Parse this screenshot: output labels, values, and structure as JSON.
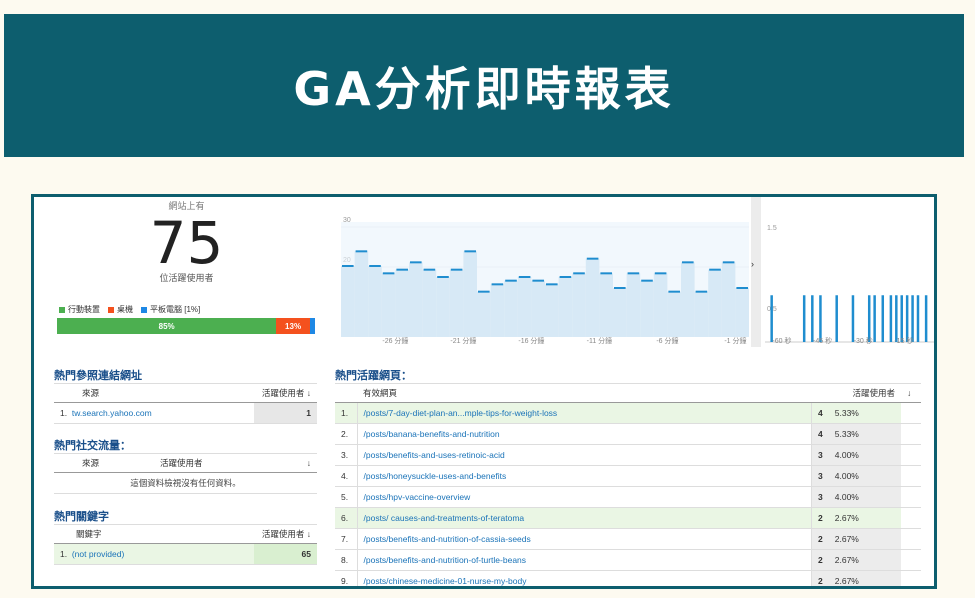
{
  "banner": {
    "title": "GA分析即時報表"
  },
  "realtime": {
    "site_label": "網站上有",
    "count": "75",
    "active_label": "位活躍使用者",
    "devices": [
      {
        "label": "行動裝置",
        "color": "#4caf50",
        "percent_label": "85%",
        "share": 0.85
      },
      {
        "label": "桌機",
        "color": "#f4511e",
        "percent_label": "13%",
        "share": 0.13
      },
      {
        "label": "平板電腦 [1%]",
        "color": "#1e88e5",
        "percent_label": "",
        "share": 0.02
      }
    ]
  },
  "chart_data": [
    {
      "type": "line",
      "ylim": [
        0,
        30
      ],
      "yticks": [
        "30",
        "20",
        "10"
      ],
      "xticks": [
        "-26 分鐘",
        "-21 分鐘",
        "-16 分鐘",
        "-11 分鐘",
        "-6 分鐘",
        "-1 分鐘"
      ],
      "x_minutes": [
        -30,
        -29,
        -28,
        -27,
        -26,
        -25,
        -24,
        -23,
        -22,
        -21,
        -20,
        -19,
        -18,
        -17,
        -16,
        -15,
        -14,
        -13,
        -12,
        -11,
        -10,
        -9,
        -8,
        -7,
        -6,
        -5,
        -4,
        -3,
        -2,
        -1
      ],
      "values": [
        18,
        22,
        18,
        16,
        17,
        19,
        17,
        15,
        17,
        22,
        11,
        13,
        14,
        15,
        14,
        13,
        15,
        16,
        20,
        16,
        12,
        16,
        14,
        16,
        11,
        19,
        11,
        17,
        19,
        12
      ]
    },
    {
      "type": "bar",
      "ylim": [
        0,
        1.5
      ],
      "yticks": [
        "1.5",
        "0.5"
      ],
      "xticks": [
        "-60 秒",
        "-45 秒",
        "-30 秒",
        "-15 秒"
      ],
      "x_seconds": [
        -60,
        -48,
        -45,
        -42,
        -36,
        -30,
        -24,
        -22,
        -19,
        -16,
        -14,
        -12,
        -10,
        -8,
        -6,
        -3
      ],
      "values": [
        1,
        1,
        1,
        1,
        1,
        1,
        1,
        1,
        1,
        1,
        1,
        1,
        1,
        1,
        1,
        1
      ]
    }
  ],
  "referrals": {
    "title": "熱門參照連結網址",
    "col_source": "來源",
    "col_users": "活躍使用者 ↓",
    "rows": [
      {
        "n": "1.",
        "source": "tw.search.yahoo.com",
        "users": "1"
      }
    ]
  },
  "social": {
    "title": "熱門社交流量：",
    "col_source": "來源",
    "col_users": "活躍使用者",
    "sort": "↓",
    "empty": "這個資料檢視沒有任何資料。"
  },
  "keywords": {
    "title": "熱門關鍵字",
    "col_keyword": "關鍵字",
    "col_users": "活躍使用者 ↓",
    "rows": [
      {
        "n": "1.",
        "keyword": "(not provided)",
        "users": "65"
      }
    ]
  },
  "pages": {
    "title": "熱門活躍網頁：",
    "col_page": "有效網頁",
    "col_users": "活躍使用者",
    "sort": "↓",
    "rows": [
      {
        "n": "1.",
        "page": "/posts/7-day-diet-plan-an...mple-tips-for-weight-loss",
        "users": "4",
        "pct": "5.33%"
      },
      {
        "n": "2.",
        "page": "/posts/banana-benefits-and-nutrition",
        "users": "4",
        "pct": "5.33%"
      },
      {
        "n": "3.",
        "page": "/posts/benefits-and-uses-retinoic-acid",
        "users": "3",
        "pct": "4.00%"
      },
      {
        "n": "4.",
        "page": "/posts/honeysuckle-uses-and-benefits",
        "users": "3",
        "pct": "4.00%"
      },
      {
        "n": "5.",
        "page": "/posts/hpv-vaccine-overview",
        "users": "3",
        "pct": "4.00%"
      },
      {
        "n": "6.",
        "page": "/posts/ causes-and-treatments-of-teratoma",
        "users": "2",
        "pct": "2.67%"
      },
      {
        "n": "7.",
        "page": "/posts/benefits-and-nutrition-of-cassia-seeds",
        "users": "2",
        "pct": "2.67%"
      },
      {
        "n": "8.",
        "page": "/posts/benefits-and-nutrition-of-turtle-beans",
        "users": "2",
        "pct": "2.67%"
      },
      {
        "n": "9.",
        "page": "/posts/chinese-medicine-01-nurse-my-body",
        "users": "2",
        "pct": "2.67%"
      }
    ]
  }
}
